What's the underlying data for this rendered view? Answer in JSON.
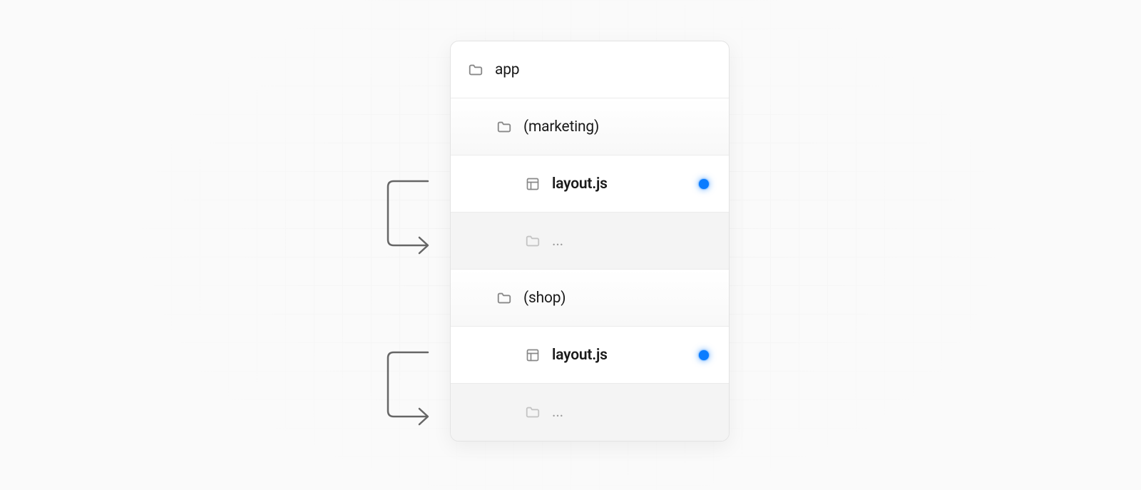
{
  "tree": {
    "root": {
      "label": "app",
      "icon": "folder"
    },
    "groups": [
      {
        "name": {
          "label": "(marketing)",
          "icon": "folder"
        },
        "layout": {
          "label": "layout.js",
          "icon": "layout",
          "dot": true
        },
        "more": {
          "label": "...",
          "icon": "folder-muted"
        }
      },
      {
        "name": {
          "label": "(shop)",
          "icon": "folder"
        },
        "layout": {
          "label": "layout.js",
          "icon": "layout",
          "dot": true
        },
        "more": {
          "label": "...",
          "icon": "folder-muted"
        }
      }
    ]
  },
  "colors": {
    "dot": "#0a7cff",
    "panelBorder": "#e3e3e3",
    "divider": "#ebebeb"
  }
}
